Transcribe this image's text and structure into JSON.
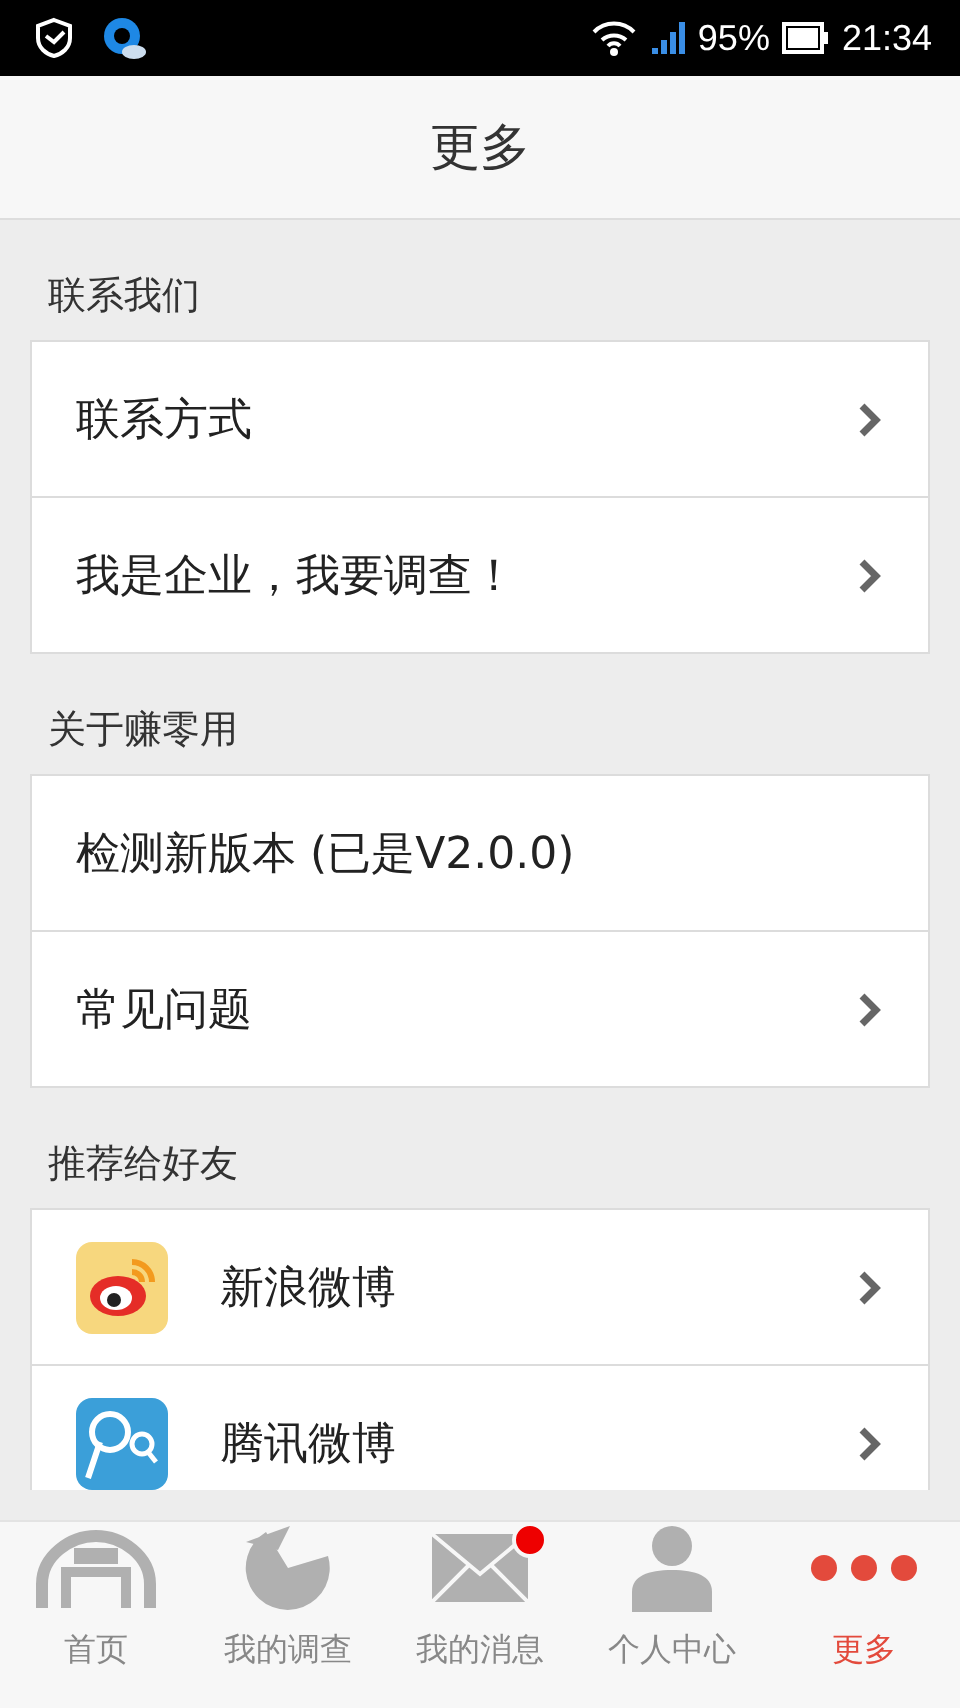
{
  "status_bar": {
    "battery": "95%",
    "time": "21:34"
  },
  "header": {
    "title": "更多"
  },
  "sections": [
    {
      "title": "联系我们",
      "items": [
        {
          "label": "联系方式",
          "has_arrow": true
        },
        {
          "label": "我是企业，我要调查！",
          "has_arrow": true
        }
      ]
    },
    {
      "title": "关于赚零用",
      "items": [
        {
          "label": "检测新版本 (已是V2.0.0)",
          "has_arrow": false
        },
        {
          "label": "常见问题",
          "has_arrow": true
        }
      ]
    },
    {
      "title": "推荐给好友",
      "items": [
        {
          "label": "新浪微博",
          "has_arrow": true,
          "kind": "weibo"
        },
        {
          "label": "腾讯微博",
          "has_arrow": true,
          "kind": "tencent"
        }
      ]
    }
  ],
  "tabs": [
    {
      "label": "首页",
      "kind": "home",
      "selected": false,
      "badge": false
    },
    {
      "label": "我的调查",
      "kind": "survey",
      "selected": false,
      "badge": false
    },
    {
      "label": "我的消息",
      "kind": "messages",
      "selected": false,
      "badge": true
    },
    {
      "label": "个人中心",
      "kind": "profile",
      "selected": false,
      "badge": false
    },
    {
      "label": "更多",
      "kind": "more",
      "selected": true,
      "badge": false
    }
  ]
}
